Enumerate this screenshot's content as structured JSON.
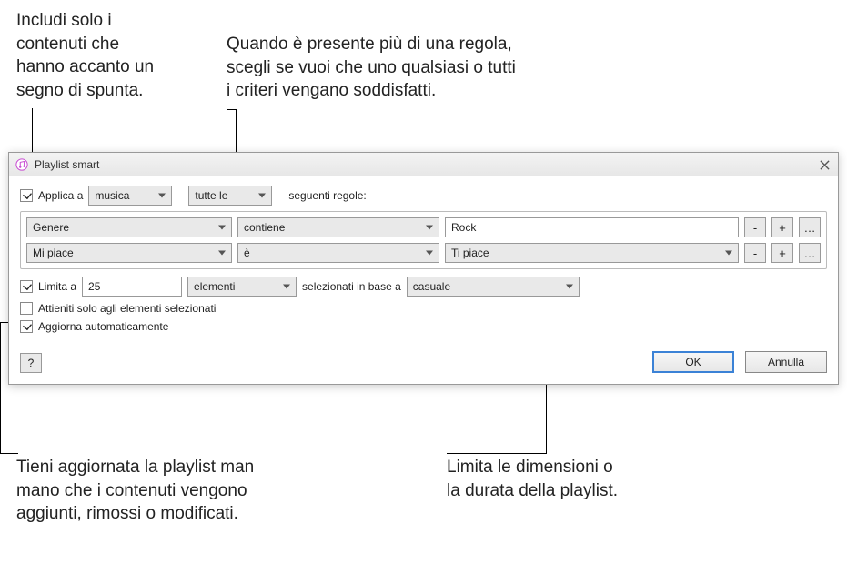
{
  "callouts": {
    "top_left": "Includi solo i\ncontenuti che\nhanno accanto un\nsegno di spunta.",
    "top_right": "Quando è presente più di una regola,\nscegli se vuoi che uno qualsiasi o tutti\ni criteri vengano soddisfatti.",
    "bottom_left": "Tieni aggiornata la playlist man\nmano che i contenuti vengono\naggiunti, rimossi o modificati.",
    "bottom_right": "Limita le dimensioni o\nla durata della playlist."
  },
  "dialog": {
    "title": "Playlist smart",
    "apply_row": {
      "checked": true,
      "label": "Applica a",
      "media_select": "musica",
      "match_select": "tutte le",
      "suffix": "seguenti regole:"
    },
    "rules": [
      {
        "field": "Genere",
        "operator": "contiene",
        "value_type": "text",
        "value": "Rock"
      },
      {
        "field": "Mi piace",
        "operator": "è",
        "value_type": "select",
        "value": "Ti piace"
      }
    ],
    "limit": {
      "checked": true,
      "label": "Limita a",
      "value": "25",
      "unit": "elementi",
      "middle_text": "selezionati in base a",
      "basis": "casuale"
    },
    "only_checked": {
      "checked": false,
      "label": "Attieniti solo agli elementi selezionati"
    },
    "live_update": {
      "checked": true,
      "label": "Aggiorna automaticamente"
    },
    "buttons": {
      "help": "?",
      "ok": "OK",
      "cancel": "Annulla",
      "minus": "-",
      "plus": "+",
      "more": "…"
    }
  }
}
